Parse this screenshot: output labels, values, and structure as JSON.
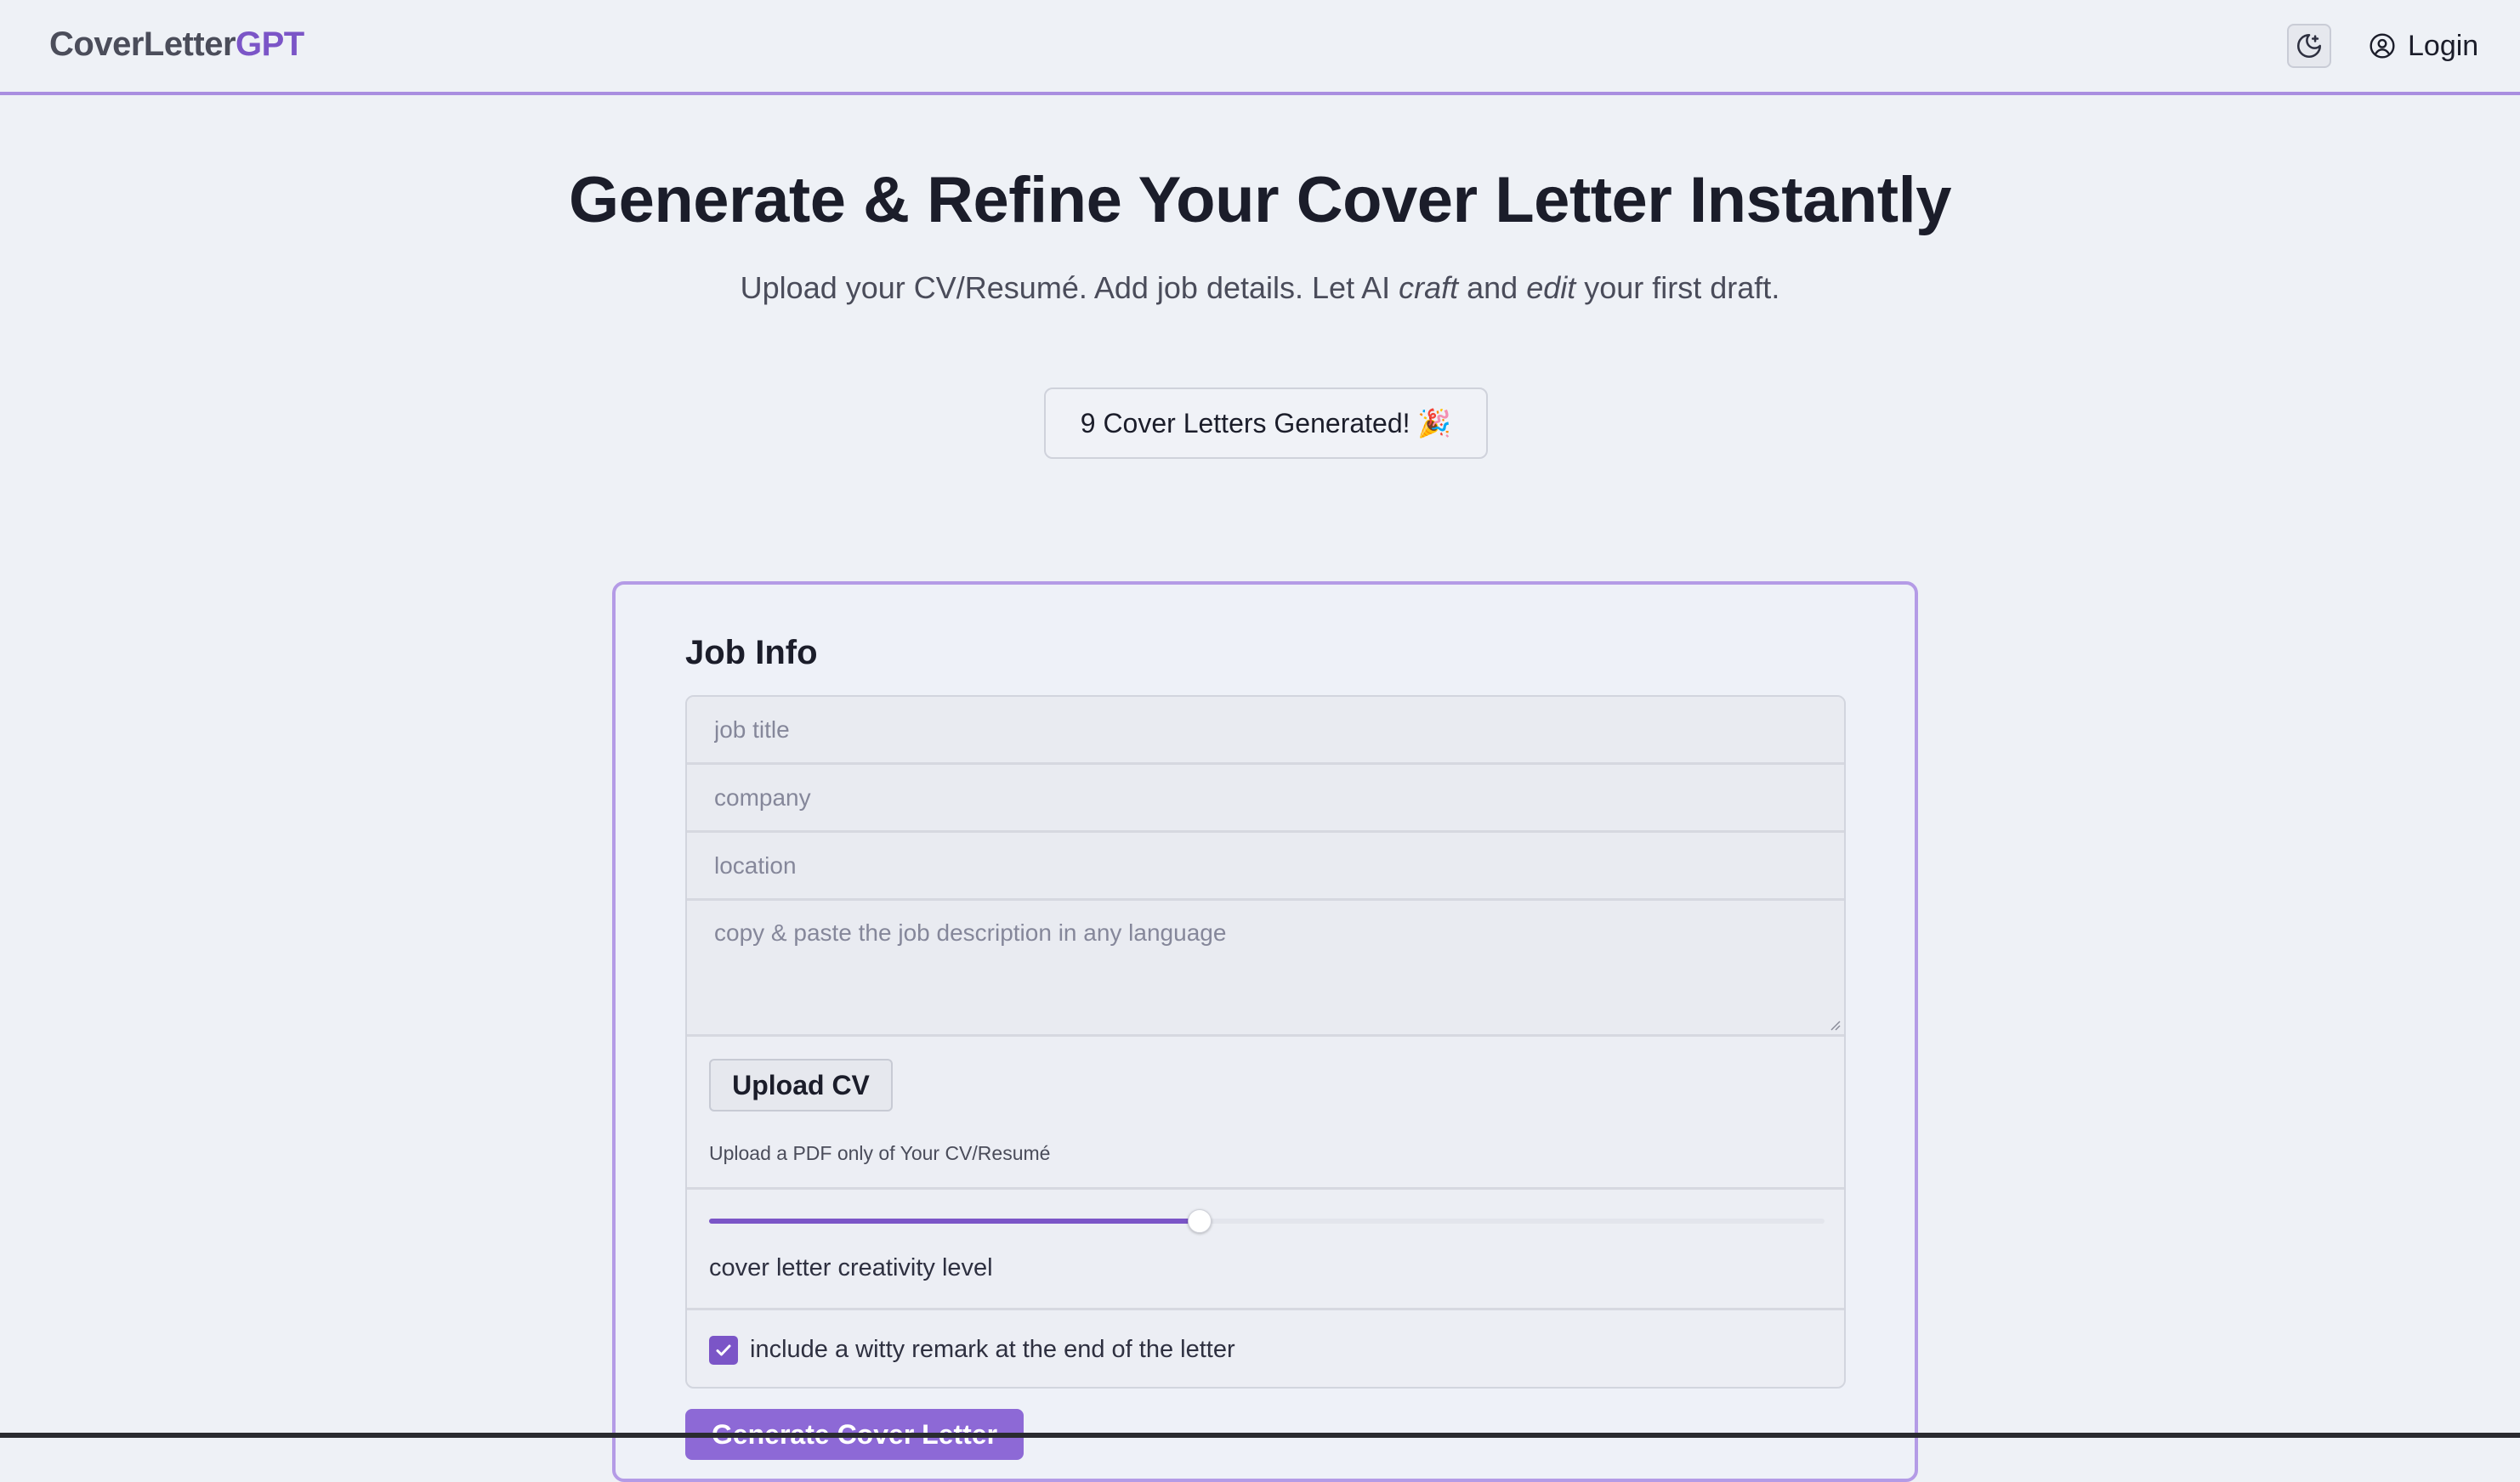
{
  "header": {
    "brand_part1": "CoverLetter",
    "brand_part2": "GPT",
    "theme_toggle_icon": "moon-stars-icon",
    "login_icon": "user-circle-icon",
    "login_label": "Login"
  },
  "hero": {
    "title": "Generate & Refine Your Cover Letter Instantly",
    "subtitle_before": "Upload your CV/Resumé. Add job details. Let AI ",
    "subtitle_em1": "craft",
    "subtitle_mid": " and ",
    "subtitle_em2": "edit",
    "subtitle_after": " your first draft.",
    "counter_text": "9 Cover Letters Generated! 🎉"
  },
  "form": {
    "section_title": "Job Info",
    "job_title": {
      "value": "",
      "placeholder": "job title"
    },
    "company": {
      "value": "",
      "placeholder": "company"
    },
    "location": {
      "value": "",
      "placeholder": "location"
    },
    "description": {
      "value": "",
      "placeholder": "copy & paste the job description in any language"
    },
    "upload_label": "Upload CV",
    "upload_hint": "Upload a PDF only of Your CV/Resumé",
    "creativity_level": 0.44,
    "creativity_label": "cover letter creativity level",
    "witty_checked": true,
    "witty_label": "include a witty remark at the end of the letter",
    "generate_label": "Generate Cover Letter"
  },
  "colors": {
    "accent": "#7b55c7",
    "accent_border": "#b49be6",
    "background": "#eef1f6"
  }
}
